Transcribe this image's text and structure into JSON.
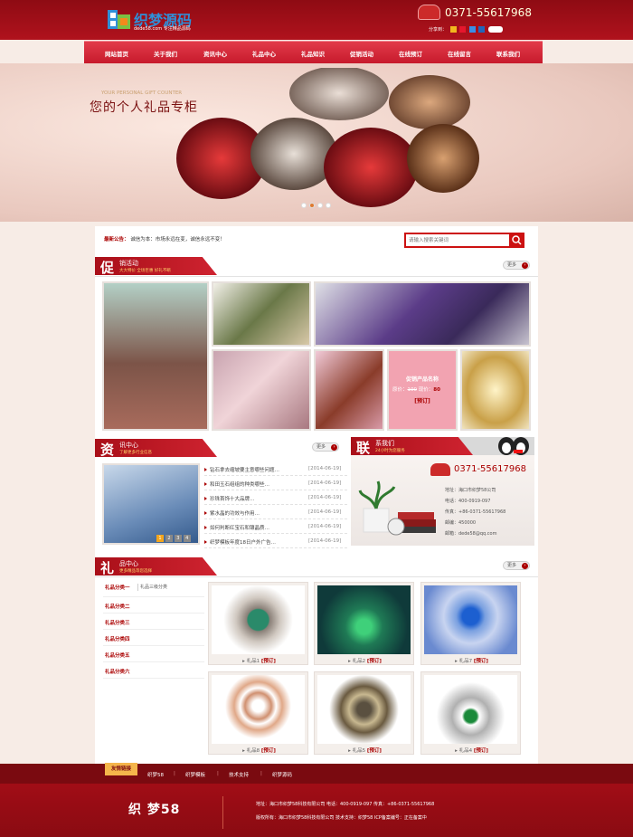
{
  "header": {
    "logo_text": "织梦源码",
    "logo_sub": "dede58.com  专注精品源码",
    "phone": "0371-55617968",
    "share_label": "分享到："
  },
  "nav": [
    "网站首页",
    "关于我们",
    "资讯中心",
    "礼品中心",
    "礼品知识",
    "促销活动",
    "在线预订",
    "在线留言",
    "联系我们"
  ],
  "banner": {
    "subtitle": "YOUR PERSONAL GIFT COUNTER",
    "title": "您的个人礼品专柜"
  },
  "notice": {
    "label": "最新公告：",
    "text": "诚信为本：市场永远在变，诚信永远不变！"
  },
  "search": {
    "placeholder": "请输入搜索关键词"
  },
  "promo": {
    "big": "促",
    "title": "销活动",
    "desc": "大大特价 全场巨惠 好礼不断",
    "more": "更多",
    "feature_title": "促销产品名称",
    "orig_label": "原价：",
    "orig_price": "100",
    "sale_label": "现价：",
    "sale_price": "80",
    "book": "[预订]"
  },
  "news": {
    "big": "资",
    "title": "讯中心",
    "desc": "了解更多行业信息",
    "more": "更多",
    "pages": [
      "1",
      "2",
      "3",
      "4"
    ],
    "items": [
      {
        "title": "钻石拿去缩坡要主意哪些问题…",
        "date": "[2014-06-19]"
      },
      {
        "title": "和田玉石组组的种类哪些…",
        "date": "[2014-06-19]"
      },
      {
        "title": "珍珠首饰十大品牌…",
        "date": "[2014-06-19]"
      },
      {
        "title": "紫水晶的功效与作用…",
        "date": "[2014-06-19]"
      },
      {
        "title": "如何判断红宝石和镶晶质…",
        "date": "[2014-06-19]"
      },
      {
        "title": "织梦模板年度18日户外广告…",
        "date": "[2014-06-19]"
      }
    ]
  },
  "contact": {
    "big": "联",
    "title": "系我们",
    "desc": "24小时为您服务",
    "phone": "0371-55617968",
    "lines": [
      "地址：海口市织梦58公司",
      "电话：400-0919-097",
      "传真：+86-0371-55617968",
      "邮编：450000",
      "邮箱：dede58@qq.com"
    ]
  },
  "gifts": {
    "big": "礼",
    "title": "品中心",
    "desc": "更多精品等您选择",
    "more": "更多",
    "categories": [
      "礼品分类一",
      "礼品分类二",
      "礼品分类三",
      "礼品分类四",
      "礼品分类五",
      "礼品分类六"
    ],
    "sub_category": "礼品三级分类",
    "products": [
      {
        "name": "礼品1",
        "book": "[预订]"
      },
      {
        "name": "礼品2",
        "book": "[预订]"
      },
      {
        "name": "礼品7",
        "book": "[预订]"
      },
      {
        "name": "礼品8",
        "book": "[预订]"
      },
      {
        "name": "礼品5",
        "book": "[预订]"
      },
      {
        "name": "礼品4",
        "book": "[预订]"
      }
    ]
  },
  "links": {
    "label": "友情链接",
    "items": [
      "织梦58",
      "织梦模板",
      "技术支持",
      "织梦源码"
    ]
  },
  "footer": {
    "logo": "织 梦58",
    "line1": "地址：海口市织梦58科技有限公司     电话：400-0919-097     传真：+86-0371-55617968",
    "line2": "版权所有：海口市织梦58科技有限公司     技术支持：织梦58     ICP备案编号：正在备案中"
  },
  "colors": {
    "brand_red": "#b0121d",
    "accent": "#c11",
    "gold": "#f5b54b"
  }
}
